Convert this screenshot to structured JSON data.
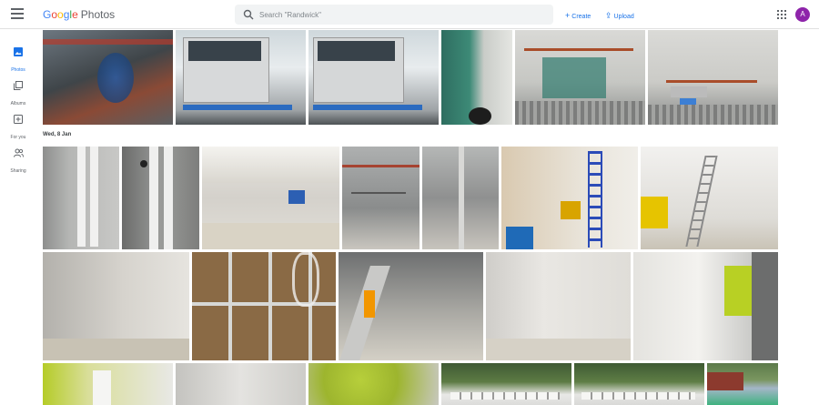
{
  "app": {
    "logo_letters": [
      "G",
      "o",
      "o",
      "g",
      "l",
      "e"
    ],
    "product": "Photos"
  },
  "search": {
    "placeholder": "Search \"Randwick\""
  },
  "actions": {
    "create": "Create",
    "upload": "Upload"
  },
  "user": {
    "initial": "A",
    "color": "#8e24aa"
  },
  "sidebar": {
    "items": [
      {
        "label": "Photos",
        "icon": "photo-icon",
        "active": true
      },
      {
        "label": "Albums",
        "icon": "album-icon",
        "active": false
      },
      {
        "label": "For you",
        "icon": "assistant-icon",
        "active": false
      },
      {
        "label": "Sharing",
        "icon": "people-icon",
        "active": false
      }
    ]
  },
  "date_groups": [
    {
      "label": "Wed, 8 Jan"
    }
  ],
  "photos": [
    {
      "desc": "scaffold-cables"
    },
    {
      "desc": "chiller-unit-1"
    },
    {
      "desc": "chiller-unit-2"
    },
    {
      "desc": "plant-room-corridor"
    },
    {
      "desc": "piping-rack-1"
    },
    {
      "desc": "piping-rack-2"
    },
    {
      "desc": "wall-pipes-1"
    },
    {
      "desc": "wall-pipes-2"
    },
    {
      "desc": "corridor-ceiling-lights"
    },
    {
      "desc": "ceiling-services-1"
    },
    {
      "desc": "ceiling-services-2"
    },
    {
      "desc": "room-ladder-blue"
    },
    {
      "desc": "room-bin-yellow"
    },
    {
      "desc": "room-blank-wall"
    },
    {
      "desc": "wall-insulation"
    },
    {
      "desc": "ladder-ingco"
    },
    {
      "desc": "white-room"
    },
    {
      "desc": "corridor-green"
    },
    {
      "desc": "green-wall"
    },
    {
      "desc": "blur-1"
    },
    {
      "desc": "blur-green"
    },
    {
      "desc": "site-cabins-1"
    },
    {
      "desc": "site-cabins-2"
    },
    {
      "desc": "trees-outdoor"
    }
  ]
}
